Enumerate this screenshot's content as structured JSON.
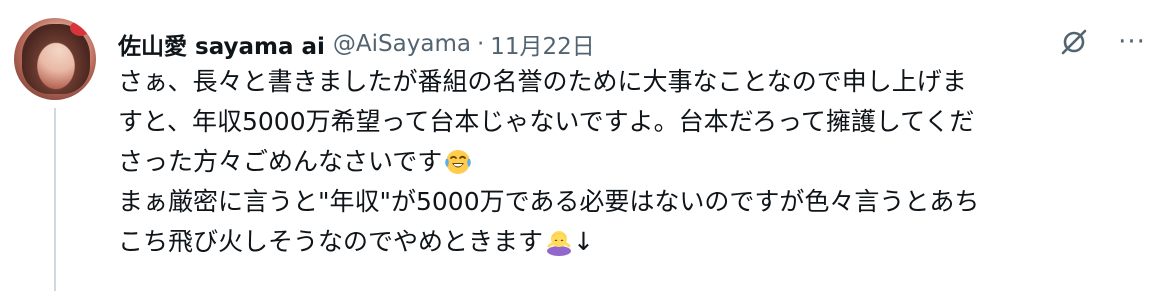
{
  "author": {
    "display_name": "佐山愛 sayama ai",
    "handle": "@AiSayama",
    "separator": "·",
    "date": "11月22日"
  },
  "icons": {
    "avatar": "profile-photo",
    "grok": "grok-icon",
    "more": "more-icon",
    "emoji_1": "face-with-tears-of-joy",
    "emoji_2": "person-bowing"
  },
  "actions": {
    "more_glyph": "···"
  },
  "tweet": {
    "line1": "さぁ、長々と書きましたが番組の名誉のために大事なことなので申し上げま",
    "line2": "すと、年収5000万希望って台本じゃないですよ。台本だろって擁護してくだ",
    "line3": "さった方々ごめんなさいです",
    "line4": "まぁ厳密に言うと\"年収\"が5000万である必要はないのですが色々言うとあち",
    "line5": "こち飛び火しそうなのでやめときます",
    "line5_suffix": "↓"
  },
  "colors": {
    "text": "#0f1419",
    "secondary": "#536471",
    "thread_line": "#cfd9de",
    "background": "#ffffff"
  }
}
